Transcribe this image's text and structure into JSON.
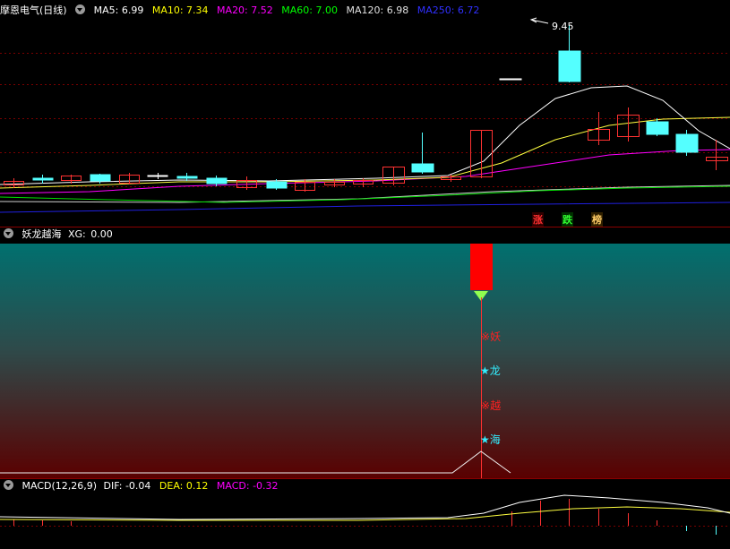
{
  "main_chart": {
    "stock_name": "摩恩电气",
    "period": "(日线)",
    "ma_legend": [
      {
        "label": "MA5:",
        "value": "6.99",
        "color": "#ffffff"
      },
      {
        "label": "MA10:",
        "value": "7.34",
        "color": "#ffff00"
      },
      {
        "label": "MA20:",
        "value": "7.52",
        "color": "#ff00ff"
      },
      {
        "label": "MA60:",
        "value": "7.00",
        "color": "#00ff00"
      },
      {
        "label": "MA120:",
        "value": "6.98",
        "color": "#e0e0e0"
      },
      {
        "label": "MA250:",
        "value": "6.72",
        "color": "#3030ff"
      }
    ],
    "high_marker": "9.45",
    "tags": [
      {
        "text": "涨",
        "bg": "#300000",
        "color": "#ff3030"
      },
      {
        "text": "跌",
        "bg": "#003000",
        "color": "#30ff30"
      },
      {
        "text": "榜",
        "bg": "#302000",
        "color": "#ffcc66"
      }
    ]
  },
  "indicator": {
    "name": "妖龙越海",
    "xg_label": "XG:",
    "xg_value": "0.00",
    "signal_labels": [
      {
        "mark": "※",
        "text": "妖",
        "color": "#ff2020"
      },
      {
        "mark": "★",
        "text": "龙",
        "color": "#33eeff"
      },
      {
        "mark": "※",
        "text": "越",
        "color": "#ff2020"
      },
      {
        "mark": "★",
        "text": "海",
        "color": "#33eeff"
      }
    ]
  },
  "macd": {
    "name": "MACD(12,26,9)",
    "dif_label": "DIF:",
    "dif_value": "-0.04",
    "dea_label": "DEA:",
    "dea_value": "0.12",
    "macd_label": "MACD:",
    "macd_value": "-0.32"
  },
  "colors": {
    "up": "#ff3232",
    "down": "#54ffff",
    "separator": "#8b0000",
    "grid": "#7a0000",
    "gradient_top": "#00706f",
    "gradient_bottom": "#5a0000"
  }
}
